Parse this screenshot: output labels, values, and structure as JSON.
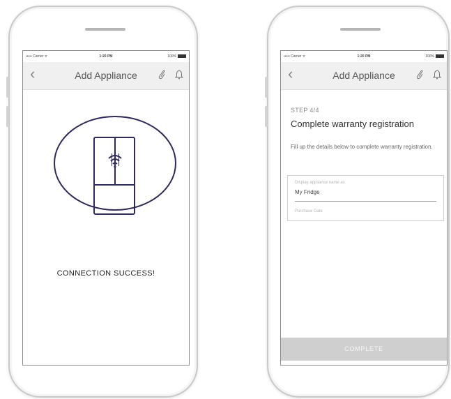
{
  "phones": [
    {
      "status": {
        "carrier": "••••• Carrier ᯤ",
        "time": "1:20 PM",
        "battery": "100%"
      },
      "appbar": {
        "title": "Add Appliance",
        "back_glyph": "‹",
        "attach_glyph": "🖇"
      },
      "main": {
        "success_text": "CONNECTION SUCCESS!"
      }
    },
    {
      "status": {
        "carrier": "••••• Carrier ᯤ",
        "time": "1:20 PM",
        "battery": "100%"
      },
      "appbar": {
        "title": "Add Appliance",
        "back_glyph": "‹",
        "attach_glyph": "🖇"
      },
      "main": {
        "step": "STEP 4/4",
        "heading": "Complete warranty registration",
        "description": "Fill up the details below to complete warranty registration.",
        "fields": [
          {
            "label": "Display appliance name as",
            "value": "My Fridge"
          },
          {
            "label": "Purchase Date",
            "value": ""
          }
        ],
        "complete_label": "COMPLETE"
      }
    }
  ],
  "icons": {
    "back": "chevron-left-icon",
    "attach": "paperclip-icon",
    "notify": "bell-icon",
    "fridge": "fridge-icon",
    "wifi": "wifi-icon",
    "battery": "battery-icon"
  },
  "colors": {
    "brand_navy": "#2f2a5c",
    "appbar_bg": "#f0f0f0",
    "button_disabled": "#cfcfcf"
  }
}
